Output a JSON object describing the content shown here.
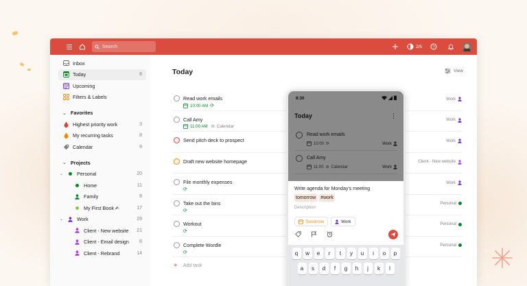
{
  "colors": {
    "brand": "#db4c3f",
    "green": "#058527",
    "orange": "#eb8909",
    "gray": "#808080"
  },
  "topbar": {
    "menu_icon": "menu-icon",
    "home_icon": "home-icon",
    "search_placeholder": "Search",
    "add_icon": "plus-icon",
    "karma_label": "2/5",
    "help_icon": "help-icon",
    "bell_icon": "bell-icon"
  },
  "sidebar": {
    "main": [
      {
        "label": "Inbox",
        "count": ""
      },
      {
        "label": "Today",
        "count": "8"
      },
      {
        "label": "Upcoming",
        "count": ""
      },
      {
        "label": "Filters & Labels",
        "count": ""
      }
    ],
    "favorites_title": "Favorites",
    "favorites": [
      {
        "label": "Highest priority work",
        "count": "3"
      },
      {
        "label": "My recurring tasks",
        "count": "8"
      },
      {
        "label": "Calendar",
        "count": "9"
      }
    ],
    "projects_title": "Projects",
    "projects": [
      {
        "label": "Personal",
        "count": "20"
      },
      {
        "label": "Home",
        "count": "11"
      },
      {
        "label": "Family",
        "count": "8"
      },
      {
        "label": "My First Book ✍",
        "count": "17"
      },
      {
        "label": "Work",
        "count": "29"
      },
      {
        "label": "Client - New website",
        "count": "21"
      },
      {
        "label": "Client - Email design",
        "count": "6"
      },
      {
        "label": "Client - Rebrand",
        "count": "14"
      }
    ]
  },
  "main": {
    "title": "Today",
    "view_label": "View",
    "tasks": [
      {
        "title": "Read work emails",
        "time": "10:00 AM",
        "extra": "",
        "project": "Work"
      },
      {
        "title": "Call Amy",
        "time": "11:00 AM",
        "extra": "Calendar",
        "project": "Work"
      },
      {
        "title": "Send pitch deck to prospect",
        "time": "",
        "extra": "",
        "project": "Work"
      },
      {
        "title": "Draft new website homepage",
        "time": "",
        "extra": "",
        "project": "Client - New website"
      },
      {
        "title": "File monthly expenses",
        "time": "",
        "extra": "",
        "project": "Work"
      },
      {
        "title": "Take out the bins",
        "time": "",
        "extra": "",
        "project": "Personal"
      },
      {
        "title": "Workout",
        "time": "",
        "extra": "",
        "project": "Personal"
      },
      {
        "title": "Complete Wordle",
        "time": "",
        "extra": "",
        "project": "Personal"
      }
    ],
    "add_task_label": "Add task"
  },
  "phone": {
    "clock": "8:30",
    "title": "Today",
    "tasks": [
      {
        "title": "Read work emails",
        "time": "10:00",
        "extra": "",
        "project": "Work"
      },
      {
        "title": "Call Amy",
        "time": "11:00",
        "extra": "Calendar",
        "project": "Work"
      }
    ],
    "input_text": "Write agenda for Monday's meeting",
    "tag_date": "tomorrow",
    "tag_label": "#work",
    "description_placeholder": "Description",
    "chip_date": "Tomorrow",
    "chip_project": "Work",
    "keyboard_row1": [
      "q",
      "w",
      "e",
      "r",
      "t",
      "y",
      "u",
      "i",
      "o",
      "p"
    ],
    "keyboard_row2": [
      "a",
      "s",
      "d",
      "f",
      "g",
      "h",
      "j",
      "k",
      "l"
    ]
  }
}
